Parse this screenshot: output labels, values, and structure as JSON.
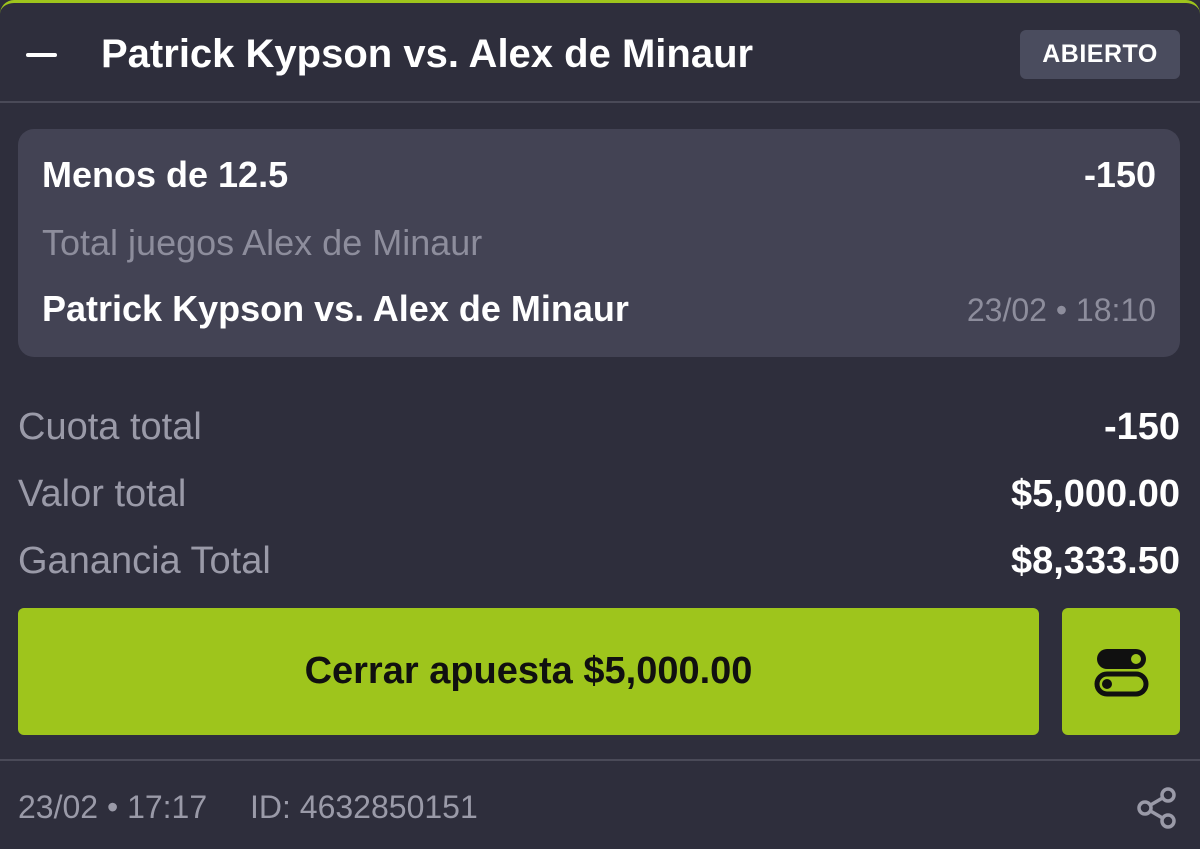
{
  "header": {
    "title": "Patrick Kypson vs. Alex de Minaur",
    "status": "ABIERTO",
    "accent_color": "#9ec51c"
  },
  "selection": {
    "market": "Menos de 12.5",
    "odds": "-150",
    "description": "Total juegos Alex de Minaur",
    "event": "Patrick Kypson vs. Alex de Minaur",
    "event_datetime": "23/02 • 18:10"
  },
  "summary": {
    "rows": [
      {
        "label": "Cuota total",
        "value": "-150"
      },
      {
        "label": "Valor total",
        "value": "$5,000.00"
      },
      {
        "label": "Ganancia Total",
        "value": "$8,333.50"
      }
    ]
  },
  "actions": {
    "cashout_label": "Cerrar apuesta $5,000.00",
    "toggle_icon": "toggle-icon"
  },
  "footer": {
    "placed_at": "23/02 • 17:17",
    "bet_id": "ID: 4632850151",
    "share_icon": "share-icon"
  }
}
